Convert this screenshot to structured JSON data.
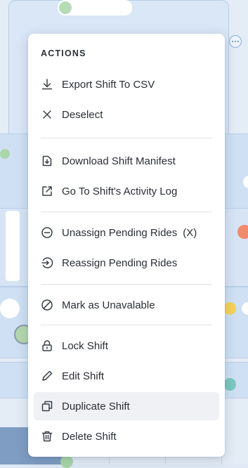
{
  "menu": {
    "heading": "ACTIONS",
    "items": [
      {
        "label": "Export Shift To CSV",
        "icon": "download-icon"
      },
      {
        "label": "Deselect",
        "icon": "close-icon"
      },
      {
        "label": "Download Shift Manifest",
        "icon": "file-download-icon"
      },
      {
        "label": "Go To Shift's Activity Log",
        "icon": "external-link-icon"
      },
      {
        "label": "Unassign Pending Rides",
        "shortcut": "(X)",
        "icon": "minus-circle-icon"
      },
      {
        "label": "Reassign Pending Rides",
        "icon": "reassign-icon"
      },
      {
        "label": "Mark as Unavalable",
        "icon": "ban-icon"
      },
      {
        "label": "Lock Shift",
        "icon": "lock-icon"
      },
      {
        "label": "Edit Shift",
        "icon": "pencil-icon"
      },
      {
        "label": "Duplicate Shift",
        "icon": "copy-icon"
      },
      {
        "label": "Delete Shift",
        "icon": "trash-icon"
      }
    ],
    "highlighted_item": "Duplicate Shift"
  },
  "colors": {
    "menu_background": "#ffffff",
    "hover_background": "#eff1f5",
    "text": "#2a2e35",
    "board_background": "#e4ecf6"
  }
}
